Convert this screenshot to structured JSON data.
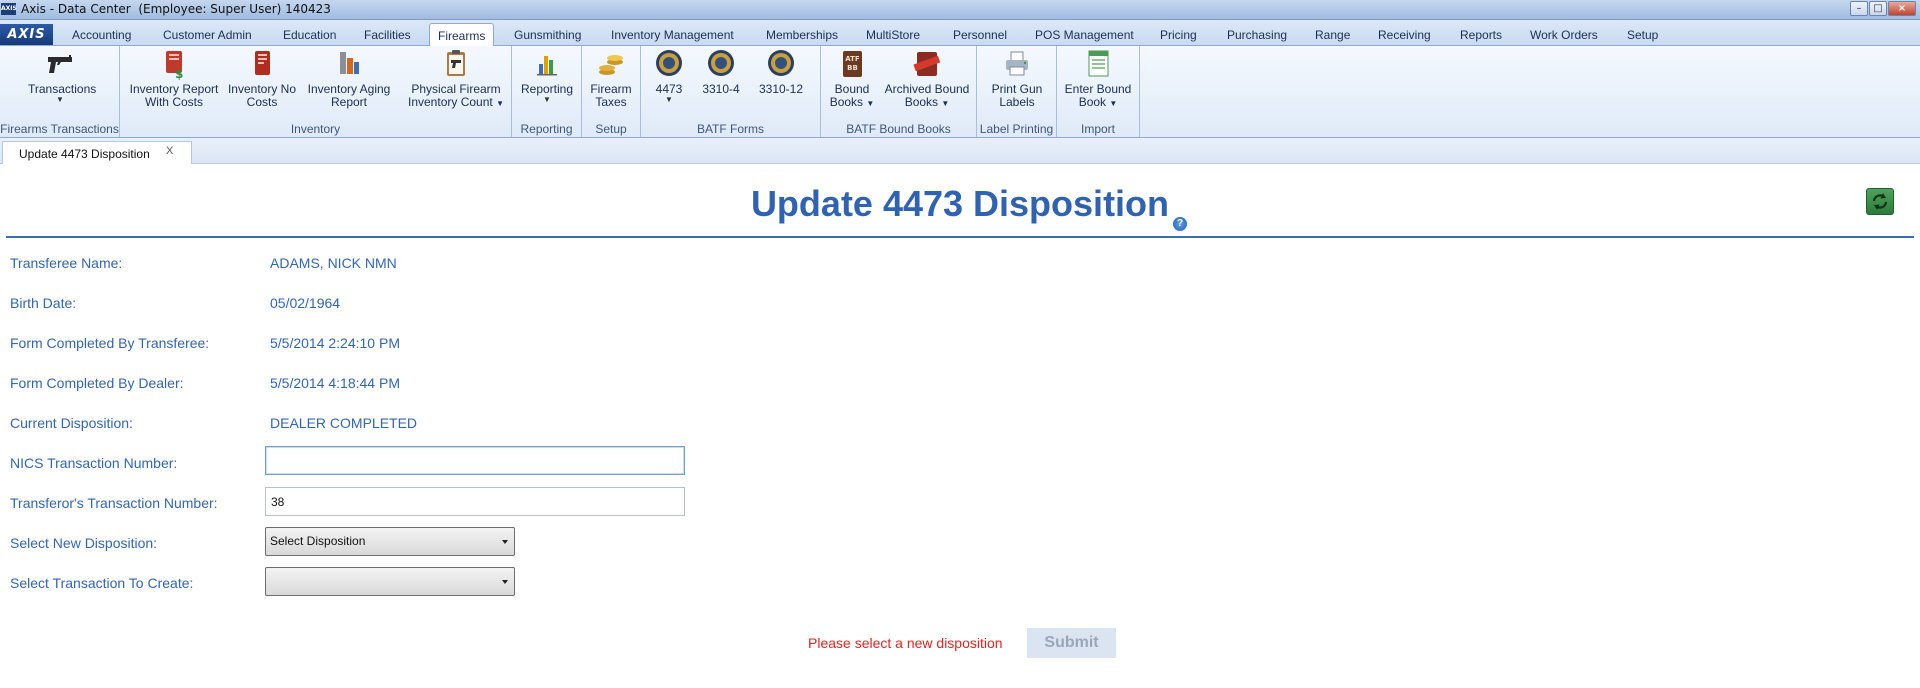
{
  "window": {
    "title": "Axis - Data Center  (Employee: Super User) 140423",
    "logo_text": "AXIS"
  },
  "menu": {
    "logo": "AXIS",
    "tabs": [
      {
        "label": "Accounting"
      },
      {
        "label": "Customer Admin"
      },
      {
        "label": "Education"
      },
      {
        "label": "Facilities"
      },
      {
        "label": "Firearms",
        "active": true
      },
      {
        "label": "Gunsmithing"
      },
      {
        "label": "Inventory Management"
      },
      {
        "label": "Memberships"
      },
      {
        "label": "MultiStore"
      },
      {
        "label": "Personnel"
      },
      {
        "label": "POS Management"
      },
      {
        "label": "Pricing"
      },
      {
        "label": "Purchasing"
      },
      {
        "label": "Range"
      },
      {
        "label": "Receiving"
      },
      {
        "label": "Reports"
      },
      {
        "label": "Work Orders"
      },
      {
        "label": "Setup"
      }
    ]
  },
  "ribbon": {
    "groups": [
      {
        "label": "Firearms Transactions",
        "buttons": [
          {
            "line1": "Transactions",
            "line2": "",
            "dropdown": true,
            "icon": "pistol-icon"
          }
        ]
      },
      {
        "label": "Inventory",
        "buttons": [
          {
            "line1": "Inventory Report",
            "line2": "With Costs",
            "icon": "report-costs-icon"
          },
          {
            "line1": "Inventory No",
            "line2": "Costs",
            "icon": "report-nocosts-icon"
          },
          {
            "line1": "Inventory Aging",
            "line2": "Report",
            "icon": "aging-chart-icon"
          },
          {
            "line1": "Physical Firearm",
            "line2": "Inventory Count",
            "dropdown": true,
            "icon": "clipboard-pistol-icon"
          }
        ]
      },
      {
        "label": "Reporting",
        "buttons": [
          {
            "line1": "Reporting",
            "line2": "",
            "dropdown": true,
            "icon": "bar-chart-icon"
          }
        ]
      },
      {
        "label": "Setup",
        "buttons": [
          {
            "line1": "Firearm",
            "line2": "Taxes",
            "icon": "coins-icon"
          }
        ]
      },
      {
        "label": "BATF Forms",
        "buttons": [
          {
            "line1": "4473",
            "line2": "",
            "dropdown": true,
            "icon": "batf-seal-icon"
          },
          {
            "line1": "3310-4",
            "line2": "",
            "icon": "batf-seal-icon"
          },
          {
            "line1": "3310-12",
            "line2": "",
            "icon": "batf-seal-icon"
          }
        ]
      },
      {
        "label": "BATF Bound Books",
        "buttons": [
          {
            "line1": "Bound",
            "line2": "Books",
            "dropdown": true,
            "icon": "atf-book-icon"
          },
          {
            "line1": "Archived Bound",
            "line2": "Books",
            "dropdown": true,
            "icon": "archived-stamp-icon"
          }
        ]
      },
      {
        "label": "Label Printing",
        "buttons": [
          {
            "line1": "Print Gun",
            "line2": "Labels",
            "icon": "printer-icon"
          }
        ]
      },
      {
        "label": "Import",
        "buttons": [
          {
            "line1": "Enter Bound",
            "line2": "Book",
            "dropdown": true,
            "icon": "spreadsheet-icon"
          }
        ]
      }
    ]
  },
  "document_tab": {
    "label": "Update 4473 Disposition",
    "close": "X"
  },
  "page": {
    "title": "Update 4473 Disposition",
    "help": "?",
    "fields": {
      "transferee_name": {
        "label": "Transferee Name:",
        "value": "ADAMS, NICK NMN"
      },
      "birth_date": {
        "label": "Birth Date:",
        "value": "05/02/1964"
      },
      "transferee_completed": {
        "label": "Form Completed By Transferee:",
        "value": "5/5/2014 2:24:10 PM"
      },
      "dealer_completed": {
        "label": "Form Completed By Dealer:",
        "value": "5/5/2014 4:18:44 PM"
      },
      "current_disposition": {
        "label": "Current Disposition:",
        "value": "DEALER COMPLETED"
      },
      "nics_number": {
        "label": "NICS Transaction Number:",
        "value": ""
      },
      "transferor_number": {
        "label": "Transferor's Transaction Number:",
        "value": "38"
      },
      "new_disposition": {
        "label": "Select New Disposition:",
        "value": "Select Disposition"
      },
      "transaction_to_create": {
        "label": "Select Transaction To Create:",
        "value": ""
      }
    },
    "validation_message": "Please select a new disposition",
    "submit_label": "Submit"
  },
  "colors": {
    "accent_blue": "#2f62b1",
    "label_blue": "#3265b4",
    "error_red": "#e02424",
    "refresh_green": "#3a8a47"
  }
}
